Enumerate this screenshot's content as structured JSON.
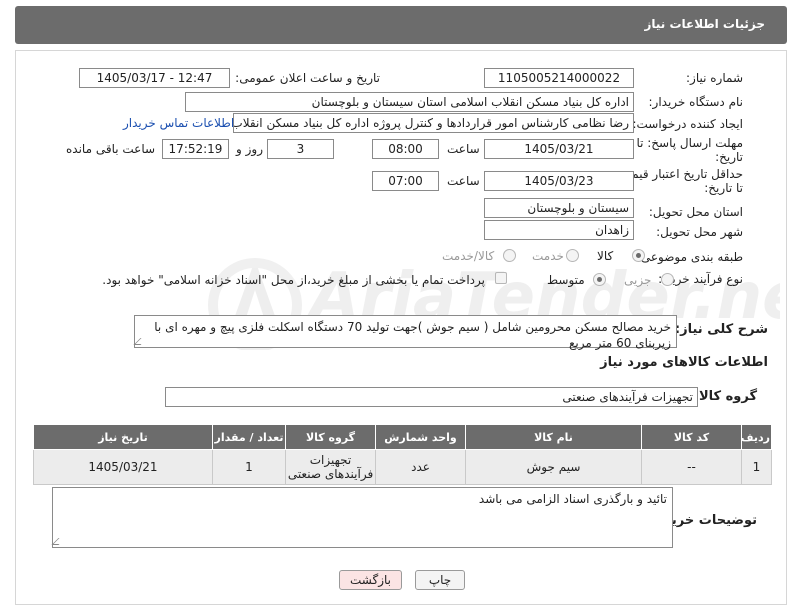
{
  "header": {
    "title": "جزئیات اطلاعات نیاز"
  },
  "fields": {
    "need_number": {
      "label": "شماره نیاز:",
      "value": "1105005214000022"
    },
    "announce_datetime": {
      "label": "تاریخ و ساعت اعلان عمومی:",
      "value": "1405/03/17 - 12:47"
    },
    "buyer_org": {
      "label": "نام دستگاه خریدار:",
      "value": "اداره کل بنیاد مسکن انقلاب اسلامی استان سیستان و بلوچستان"
    },
    "requester": {
      "label": "ایجاد کننده درخواست:",
      "value": "رضا نظامی کارشناس امور قراردادها و کنترل پروژه اداره کل بنیاد مسکن انقلاب اس",
      "contact_link": "اطلاعات تماس خریدار"
    },
    "reply_deadline": {
      "label_line1": "مهلت ارسال پاسخ: تا",
      "label_line2": "تاریخ:",
      "date": "1405/03/21",
      "time_label": "ساعت",
      "time": "08:00",
      "days": "3",
      "days_label": "روز و",
      "remaining": "17:52:19",
      "remaining_label": "ساعت باقی مانده"
    },
    "price_validity": {
      "label_line1": "حداقل تاریخ اعتبار قیمت:",
      "label_line2": "تا تاریخ:",
      "date": "1405/03/23",
      "time_label": "ساعت",
      "time": "07:00"
    },
    "delivery_province": {
      "label": "استان محل تحویل:",
      "value": "سیستان و بلوچستان"
    },
    "delivery_city": {
      "label": "شهر محل تحویل:",
      "value": "زاهدان"
    },
    "category": {
      "label": "طبقه بندی موضوعی:",
      "options": [
        "کالا",
        "خدمت",
        "کالا/خدمت"
      ],
      "selected": "کالا"
    },
    "purchase_process": {
      "label": "نوع فرآیند خرید :",
      "options": [
        "جزیی",
        "متوسط"
      ],
      "selected": "متوسط",
      "payment_note": "پرداخت تمام یا بخشی از مبلغ خرید،از محل \"اسناد خزانه اسلامی\" خواهد بود."
    }
  },
  "description": {
    "label": "شرح کلی نیاز:",
    "text": "خرید مصالح مسکن محرومین شامل ( سیم جوش )جهت تولید 70 دستگاه اسکلت فلزی پیچ و مهره ای با زیربنای 60 متر مربع"
  },
  "goods_section": {
    "title": "اطلاعات کالاهای مورد نیاز",
    "group_label": "گروه کالا:",
    "group_value": "تجهیزات فرآیندهای صنعتی"
  },
  "table": {
    "headers": [
      "ردیف",
      "کد کالا",
      "نام کالا",
      "واحد شمارش",
      "گروه کالا",
      "تعداد / مقدار",
      "تاریخ نیاز"
    ],
    "rows": [
      [
        "1",
        "--",
        "سیم جوش",
        "عدد",
        "تجهیزات فرآیندهای صنعتی",
        "1",
        "1405/03/21"
      ]
    ]
  },
  "buyer_notes": {
    "label": "توضیحات خریدار:",
    "text": "تائید و بارگذری اسناد الزامی می باشد"
  },
  "buttons": {
    "print": "چاپ",
    "back": "بازگشت"
  },
  "watermark": {
    "text": "AriaTender.neT"
  }
}
